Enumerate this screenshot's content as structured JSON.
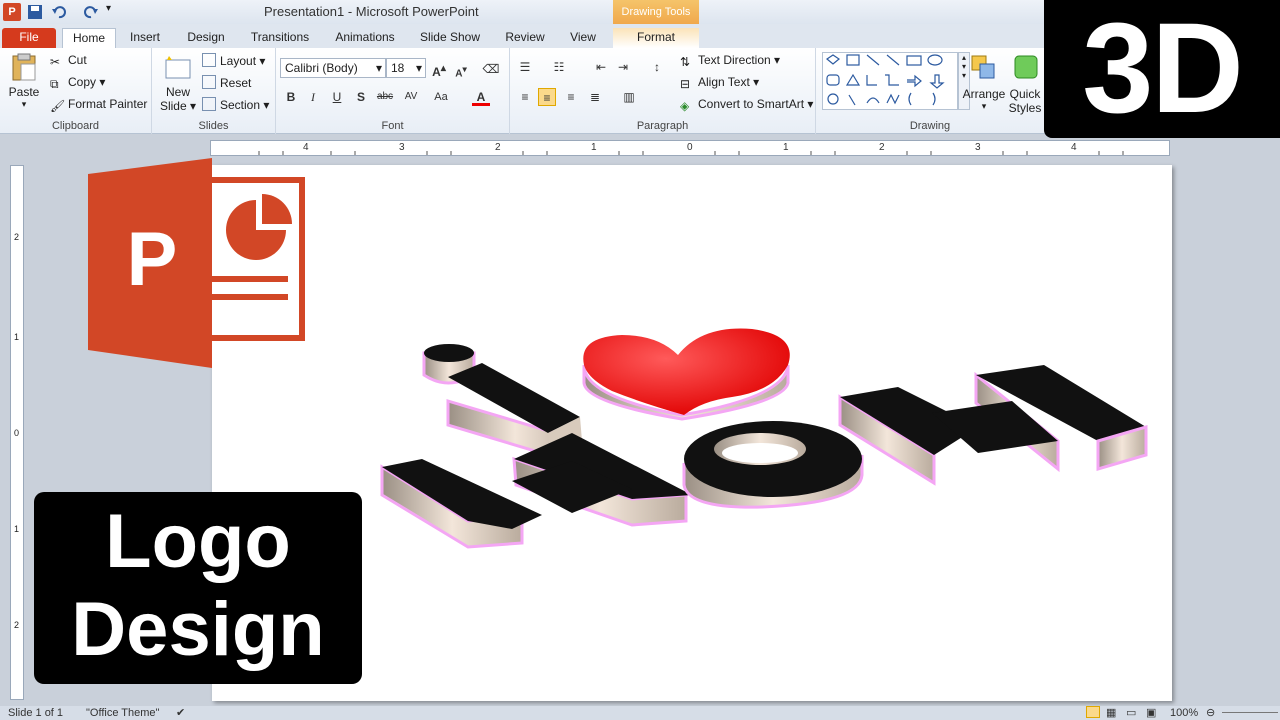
{
  "window": {
    "title": "Presentation1  -  Microsoft PowerPoint",
    "context_tab_group": "Drawing Tools",
    "app_icon_letter": "P"
  },
  "tabs": [
    "File",
    "Home",
    "Insert",
    "Design",
    "Transitions",
    "Animations",
    "Slide Show",
    "Review",
    "View",
    "Format"
  ],
  "ribbon": {
    "clipboard": {
      "paste": "Paste",
      "cut": "Cut",
      "copy": "Copy",
      "format_painter": "Format Painter",
      "label": "Clipboard"
    },
    "slides": {
      "new_slide_1": "New",
      "new_slide_2": "Slide",
      "layout": "Layout",
      "reset": "Reset",
      "section": "Section",
      "label": "Slides"
    },
    "font": {
      "font_name": "Calibri (Body)",
      "font_size": "18",
      "label": "Font"
    },
    "paragraph": {
      "text_direction": "Text Direction",
      "align_text": "Align Text",
      "convert_smartart": "Convert to SmartArt",
      "label": "Paragraph"
    },
    "drawing": {
      "arrange": "Arrange",
      "quick_styles_1": "Quick",
      "quick_styles_2": "Styles",
      "label": "Drawing"
    }
  },
  "ruler": {
    "h_ticks": [
      "4",
      "3",
      "2",
      "1",
      "0",
      "1",
      "2",
      "3",
      "4"
    ],
    "v_ticks": [
      "2",
      "1",
      "0",
      "1",
      "2"
    ]
  },
  "slide": {
    "logo_letters": [
      "i",
      "M",
      "O",
      "M"
    ],
    "colors": {
      "extrusion_top": "#000000",
      "extrusion_side": "#e8dccf",
      "heart": "#ff1a1a",
      "glow": "#ff66ff"
    }
  },
  "status": {
    "slide_info": "Slide 1 of 1",
    "theme": "\"Office Theme\"",
    "zoom": "100%"
  },
  "overlay": {
    "badge_3d": "3D",
    "badge_logo_line1": "Logo",
    "badge_logo_line2": "Design"
  },
  "powerpoint_logo": {
    "letter": "P",
    "color": "#d24726"
  }
}
